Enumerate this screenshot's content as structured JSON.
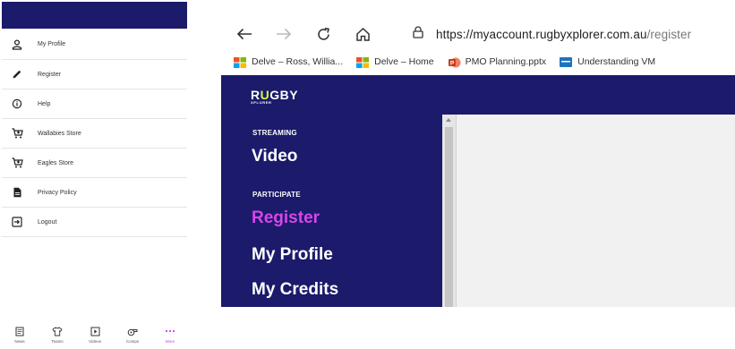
{
  "phone": {
    "menu": [
      {
        "label": "My Profile",
        "icon": "person-icon"
      },
      {
        "label": "Register",
        "icon": "pencil-icon"
      },
      {
        "label": "Help",
        "icon": "info-icon"
      },
      {
        "label": "Wallabies Store",
        "icon": "cart-icon"
      },
      {
        "label": "Eagles Store",
        "icon": "cart-icon"
      },
      {
        "label": "Privacy Policy",
        "icon": "document-icon"
      },
      {
        "label": "Logout",
        "icon": "logout-icon"
      }
    ],
    "bottom_nav": [
      {
        "label": "News",
        "icon": "news-icon",
        "active": false
      },
      {
        "label": "Teams",
        "icon": "shirt-icon",
        "active": false
      },
      {
        "label": "Videos",
        "icon": "play-icon",
        "active": false
      },
      {
        "label": "Comps",
        "icon": "whistle-icon",
        "active": false
      },
      {
        "label": "More",
        "icon": "more-icon",
        "active": true
      }
    ]
  },
  "browser": {
    "url": {
      "host": "https://myaccount.rugbyxplorer.com.au",
      "path": "/register"
    },
    "bookmarks": [
      {
        "label": "Delve – Ross, Willia...",
        "icon": "windows-logo-icon"
      },
      {
        "label": "Delve – Home",
        "icon": "windows-logo-icon"
      },
      {
        "label": "PMO Planning.pptx",
        "icon": "powerpoint-icon"
      },
      {
        "label": "Understanding VM",
        "icon": "bookmark-icon"
      }
    ]
  },
  "site": {
    "logo": {
      "part1": "R",
      "part2": "U",
      "part3": "GBY",
      "sub": "XPLORER"
    },
    "sections": {
      "streaming": "STREAMING",
      "participate": "PARTICIPATE"
    },
    "nav": {
      "video": "Video",
      "register": "Register",
      "my_profile": "My Profile",
      "my_credits": "My Credits"
    }
  },
  "colors": {
    "brand_navy": "#1b1a6b",
    "accent_magenta": "#d646ea",
    "logo_lime": "#d8ff3a"
  }
}
